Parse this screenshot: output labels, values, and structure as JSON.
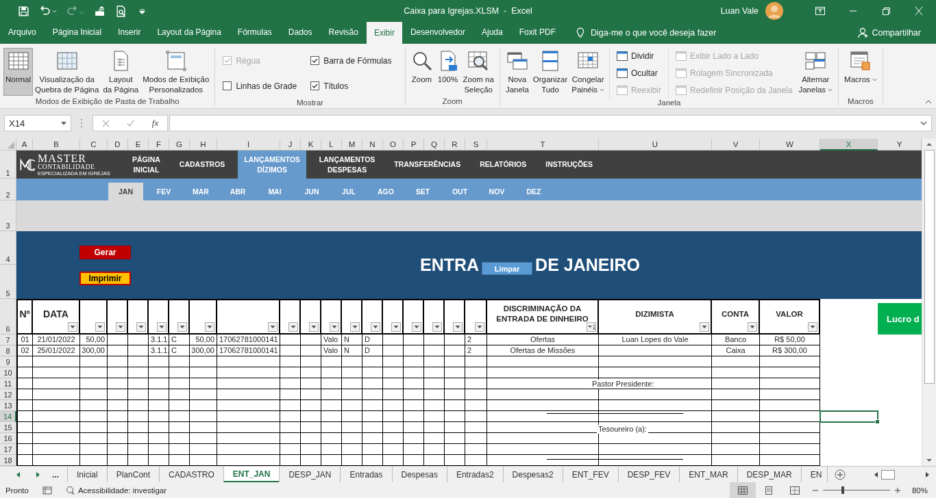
{
  "title_bar": {
    "title": "Caixa para Igrejas.XLSM  -  Excel",
    "user": "Luan Vale"
  },
  "ribbon_tabs": [
    {
      "label": "Arquivo",
      "selected": false
    },
    {
      "label": "Página Inicial",
      "selected": false
    },
    {
      "label": "Inserir",
      "selected": false
    },
    {
      "label": "Layout da Página",
      "selected": false
    },
    {
      "label": "Fórmulas",
      "selected": false
    },
    {
      "label": "Dados",
      "selected": false
    },
    {
      "label": "Revisão",
      "selected": false
    },
    {
      "label": "Exibir",
      "selected": true
    },
    {
      "label": "Desenvolvedor",
      "selected": false
    },
    {
      "label": "Ajuda",
      "selected": false
    },
    {
      "label": "Foxit PDF",
      "selected": false
    }
  ],
  "tell_me": "Diga-me o que você deseja fazer",
  "share": "Compartilhar",
  "ribbon_groups": [
    {
      "label": "Modos de Exibição de Pasta de Trabalho",
      "items": [
        {
          "kind": "large",
          "label": "Normal",
          "selected": true,
          "dropdown": false
        },
        {
          "kind": "large",
          "label": "Visualização da\nQuebra de Página",
          "selected": false,
          "dropdown": false
        },
        {
          "kind": "large",
          "label": "Layout\nda Página",
          "selected": false,
          "dropdown": false
        },
        {
          "kind": "large",
          "label": "Modos de Exibição\nPersonalizados",
          "selected": false,
          "dropdown": false
        }
      ]
    },
    {
      "label": "Mostrar",
      "items": [
        {
          "kind": "stack",
          "items": [
            {
              "kind": "check",
              "label": "Régua",
              "checked": true,
              "disabled": true
            },
            {
              "kind": "check",
              "label": "Linhas de Grade",
              "checked": false,
              "disabled": false
            }
          ]
        },
        {
          "kind": "stack",
          "items": [
            {
              "kind": "check",
              "label": "Barra de Fórmulas",
              "checked": true,
              "disabled": false
            },
            {
              "kind": "check",
              "label": "Títulos",
              "checked": true,
              "disabled": false
            }
          ]
        }
      ]
    },
    {
      "label": "Zoom",
      "items": [
        {
          "kind": "large",
          "label": "Zoom",
          "dropdown": false
        },
        {
          "kind": "large",
          "label": "100%",
          "dropdown": false
        },
        {
          "kind": "large",
          "label": "Zoom na\nSeleção",
          "dropdown": false
        }
      ]
    },
    {
      "label": "Janela",
      "items": [
        {
          "kind": "large",
          "label": "Nova\nJanela",
          "dropdown": false
        },
        {
          "kind": "large",
          "label": "Organizar\nTudo",
          "dropdown": false
        },
        {
          "kind": "large",
          "label": "Congelar\nPainéis",
          "dropdown": true
        },
        {
          "kind": "stack",
          "items": [
            {
              "kind": "small",
              "label": "Dividir",
              "disabled": false
            },
            {
              "kind": "small",
              "label": "Ocultar",
              "disabled": false
            },
            {
              "kind": "small",
              "label": "Reexibir",
              "disabled": true
            }
          ]
        },
        {
          "kind": "stack",
          "items": [
            {
              "kind": "small",
              "label": "Exibir Lado a Lado",
              "disabled": true
            },
            {
              "kind": "small",
              "label": "Rolagem Sincronizada",
              "disabled": true
            },
            {
              "kind": "small",
              "label": "Redefinir Posição da Janela",
              "disabled": true
            }
          ]
        },
        {
          "kind": "large",
          "label": "Alternar\nJanelas",
          "dropdown": true
        }
      ]
    },
    {
      "label": "Macros",
      "items": [
        {
          "kind": "large",
          "label": "Macros",
          "dropdown": true
        }
      ]
    }
  ],
  "name_box": "X14",
  "formula_label": "fx",
  "column_headers": [
    {
      "label": "A",
      "selected": false
    },
    {
      "label": "B",
      "selected": false
    },
    {
      "label": "C",
      "selected": false
    },
    {
      "label": "D",
      "selected": false
    },
    {
      "label": "E",
      "selected": false
    },
    {
      "label": "F",
      "selected": false
    },
    {
      "label": "G",
      "selected": false
    },
    {
      "label": "H",
      "selected": false
    },
    {
      "label": "I",
      "selected": false
    },
    {
      "label": "J",
      "selected": false
    },
    {
      "label": "K",
      "selected": false
    },
    {
      "label": "L",
      "selected": false
    },
    {
      "label": "M",
      "selected": false
    },
    {
      "label": "N",
      "selected": false
    },
    {
      "label": "O",
      "selected": false
    },
    {
      "label": "P",
      "selected": false
    },
    {
      "label": "Q",
      "selected": false
    },
    {
      "label": "R",
      "selected": false
    },
    {
      "label": "S",
      "selected": false
    },
    {
      "label": "T",
      "selected": false
    },
    {
      "label": "U",
      "selected": false
    },
    {
      "label": "V",
      "selected": false
    },
    {
      "label": "W",
      "selected": false
    },
    {
      "label": "X",
      "selected": true
    },
    {
      "label": "Y",
      "selected": false
    }
  ],
  "row_headers": [
    {
      "label": "1",
      "selected": false
    },
    {
      "label": "2",
      "selected": false
    },
    {
      "label": "3",
      "selected": false
    },
    {
      "label": "4",
      "selected": false
    },
    {
      "label": "5",
      "selected": false
    },
    {
      "label": "6",
      "selected": false
    },
    {
      "label": "7",
      "selected": false
    },
    {
      "label": "8",
      "selected": false
    },
    {
      "label": "9",
      "selected": false
    },
    {
      "label": "10",
      "selected": false
    },
    {
      "label": "11",
      "selected": false
    },
    {
      "label": "12",
      "selected": false
    },
    {
      "label": "13",
      "selected": false
    },
    {
      "label": "14",
      "selected": true
    },
    {
      "label": "15",
      "selected": false
    },
    {
      "label": "16",
      "selected": false
    },
    {
      "label": "17",
      "selected": false
    },
    {
      "label": "18",
      "selected": false
    }
  ],
  "logo": {
    "name": "MASTER",
    "subtitle": "CONTABILIDADE",
    "tagline": "ESPECIALIZADA EM IGREJAS"
  },
  "nav": [
    {
      "label": "PÁGINA\nINICIAL",
      "selected": false
    },
    {
      "label": "CADASTROS",
      "selected": false
    },
    {
      "label": "LANÇAMENTOS\nDÍZIMOS",
      "selected": true
    },
    {
      "label": "LANÇAMENTOS\nDESPESAS",
      "selected": false
    },
    {
      "label": "TRANSFERÊNCIAS",
      "selected": false
    },
    {
      "label": "RELATÓRIOS",
      "selected": false
    },
    {
      "label": "INSTRUÇÕES",
      "selected": false
    }
  ],
  "months": [
    {
      "label": "JAN",
      "selected": true
    },
    {
      "label": "FEV",
      "selected": false
    },
    {
      "label": "MAR",
      "selected": false
    },
    {
      "label": "ABR",
      "selected": false
    },
    {
      "label": "MAI",
      "selected": false
    },
    {
      "label": "JUN",
      "selected": false
    },
    {
      "label": "JUL",
      "selected": false
    },
    {
      "label": "AGO",
      "selected": false
    },
    {
      "label": "SET",
      "selected": false
    },
    {
      "label": "OUT",
      "selected": false
    },
    {
      "label": "NOV",
      "selected": false
    },
    {
      "label": "DEZ",
      "selected": false
    }
  ],
  "actions": {
    "generate": "Gerar",
    "print": "Imprimir",
    "clear": "Limpar"
  },
  "heading": {
    "start": "ENTRA",
    "end": "DE JANEIRO"
  },
  "table": {
    "header": [
      {
        "text": "Nº",
        "filter": false,
        "sorted": false
      },
      {
        "text": "DATA",
        "filter": true,
        "sorted": false
      },
      {
        "filter": true,
        "sorted": false
      },
      {
        "filter": true,
        "sorted": false
      },
      {
        "filter": true,
        "sorted": false
      },
      {
        "filter": true,
        "sorted": false
      },
      {
        "filter": true,
        "sorted": false
      },
      {
        "filter": true,
        "sorted": false
      },
      {
        "filter": true,
        "sorted": false
      },
      {
        "filter": true,
        "sorted": false
      },
      {
        "filter": true,
        "sorted": false
      },
      {
        "filter": true,
        "sorted": false
      },
      {
        "filter": true,
        "sorted": false
      },
      {
        "filter": true,
        "sorted": false
      },
      {
        "filter": true,
        "sorted": false
      },
      {
        "filter": true,
        "sorted": false
      },
      {
        "filter": true,
        "sorted": false
      },
      {
        "filter": true,
        "sorted": false
      },
      {
        "filter": true,
        "sorted": false
      },
      {
        "text": "DISCRIMINAÇÃO DA\nENTRADA DE DINHEIRO",
        "filter": true,
        "sorted": true
      },
      {
        "text": "DIZIMISTA",
        "filter": true,
        "sorted": false
      },
      {
        "text": "CONTA",
        "filter": true,
        "sorted": false
      },
      {
        "text": "VALOR",
        "filter": true,
        "sorted": false
      }
    ],
    "rows": [
      {
        "number": "01",
        "date": "21/01/2022",
        "column_c": "50,00",
        "column_f": "3.1.1.",
        "column_g": "C",
        "column_h": "50,00",
        "column_i": "17062781000141",
        "column_l": "Valo",
        "column_m": "N",
        "column_n": "D",
        "column_s": "2",
        "discrimination": "Ofertas",
        "tither": "Luan Lopes do Vale",
        "account": "Banco",
        "value": "R$ 50,00"
      },
      {
        "number": "02",
        "date": "25/01/2022",
        "column_c": "300,00",
        "column_f": "3.1.1.",
        "column_g": "C",
        "column_h": "300,00",
        "column_i": "17062781000141",
        "column_l": "Valo",
        "column_m": "N",
        "column_n": "D",
        "column_s": "2",
        "discrimination": "Ofertas de Missões",
        "account": "Caixa",
        "value": "R$ 300,00"
      }
    ]
  },
  "side_label": "Lucro d",
  "signatures": [
    "Pastor Presidente:",
    "Tesoureiro (a):"
  ],
  "tab_overflow": "...",
  "sheet_tabs": [
    {
      "label": "Inicial",
      "selected": false
    },
    {
      "label": "PlanCont",
      "selected": false
    },
    {
      "label": "CADASTRO",
      "selected": false
    },
    {
      "label": "ENT_JAN",
      "selected": true
    },
    {
      "label": "DESP_JAN",
      "selected": false
    },
    {
      "label": "Entradas",
      "selected": false
    },
    {
      "label": "Despesas",
      "selected": false
    },
    {
      "label": "Entradas2",
      "selected": false
    },
    {
      "label": "Despesas2",
      "selected": false
    },
    {
      "label": "ENT_FEV",
      "selected": false
    },
    {
      "label": "DESP_FEV",
      "selected": false
    },
    {
      "label": "ENT_MAR",
      "selected": false
    },
    {
      "label": "DESP_MAR",
      "selected": false
    },
    {
      "label": "EN",
      "selected": false
    }
  ],
  "status": {
    "ready": "Pronto",
    "accessibility": "Acessibilidade: investigar",
    "views": [
      {
        "selected": true
      },
      {
        "selected": false
      },
      {
        "selected": false
      }
    ],
    "zoom_slider": {
      "level": 0.3
    },
    "zoom": "80%"
  }
}
